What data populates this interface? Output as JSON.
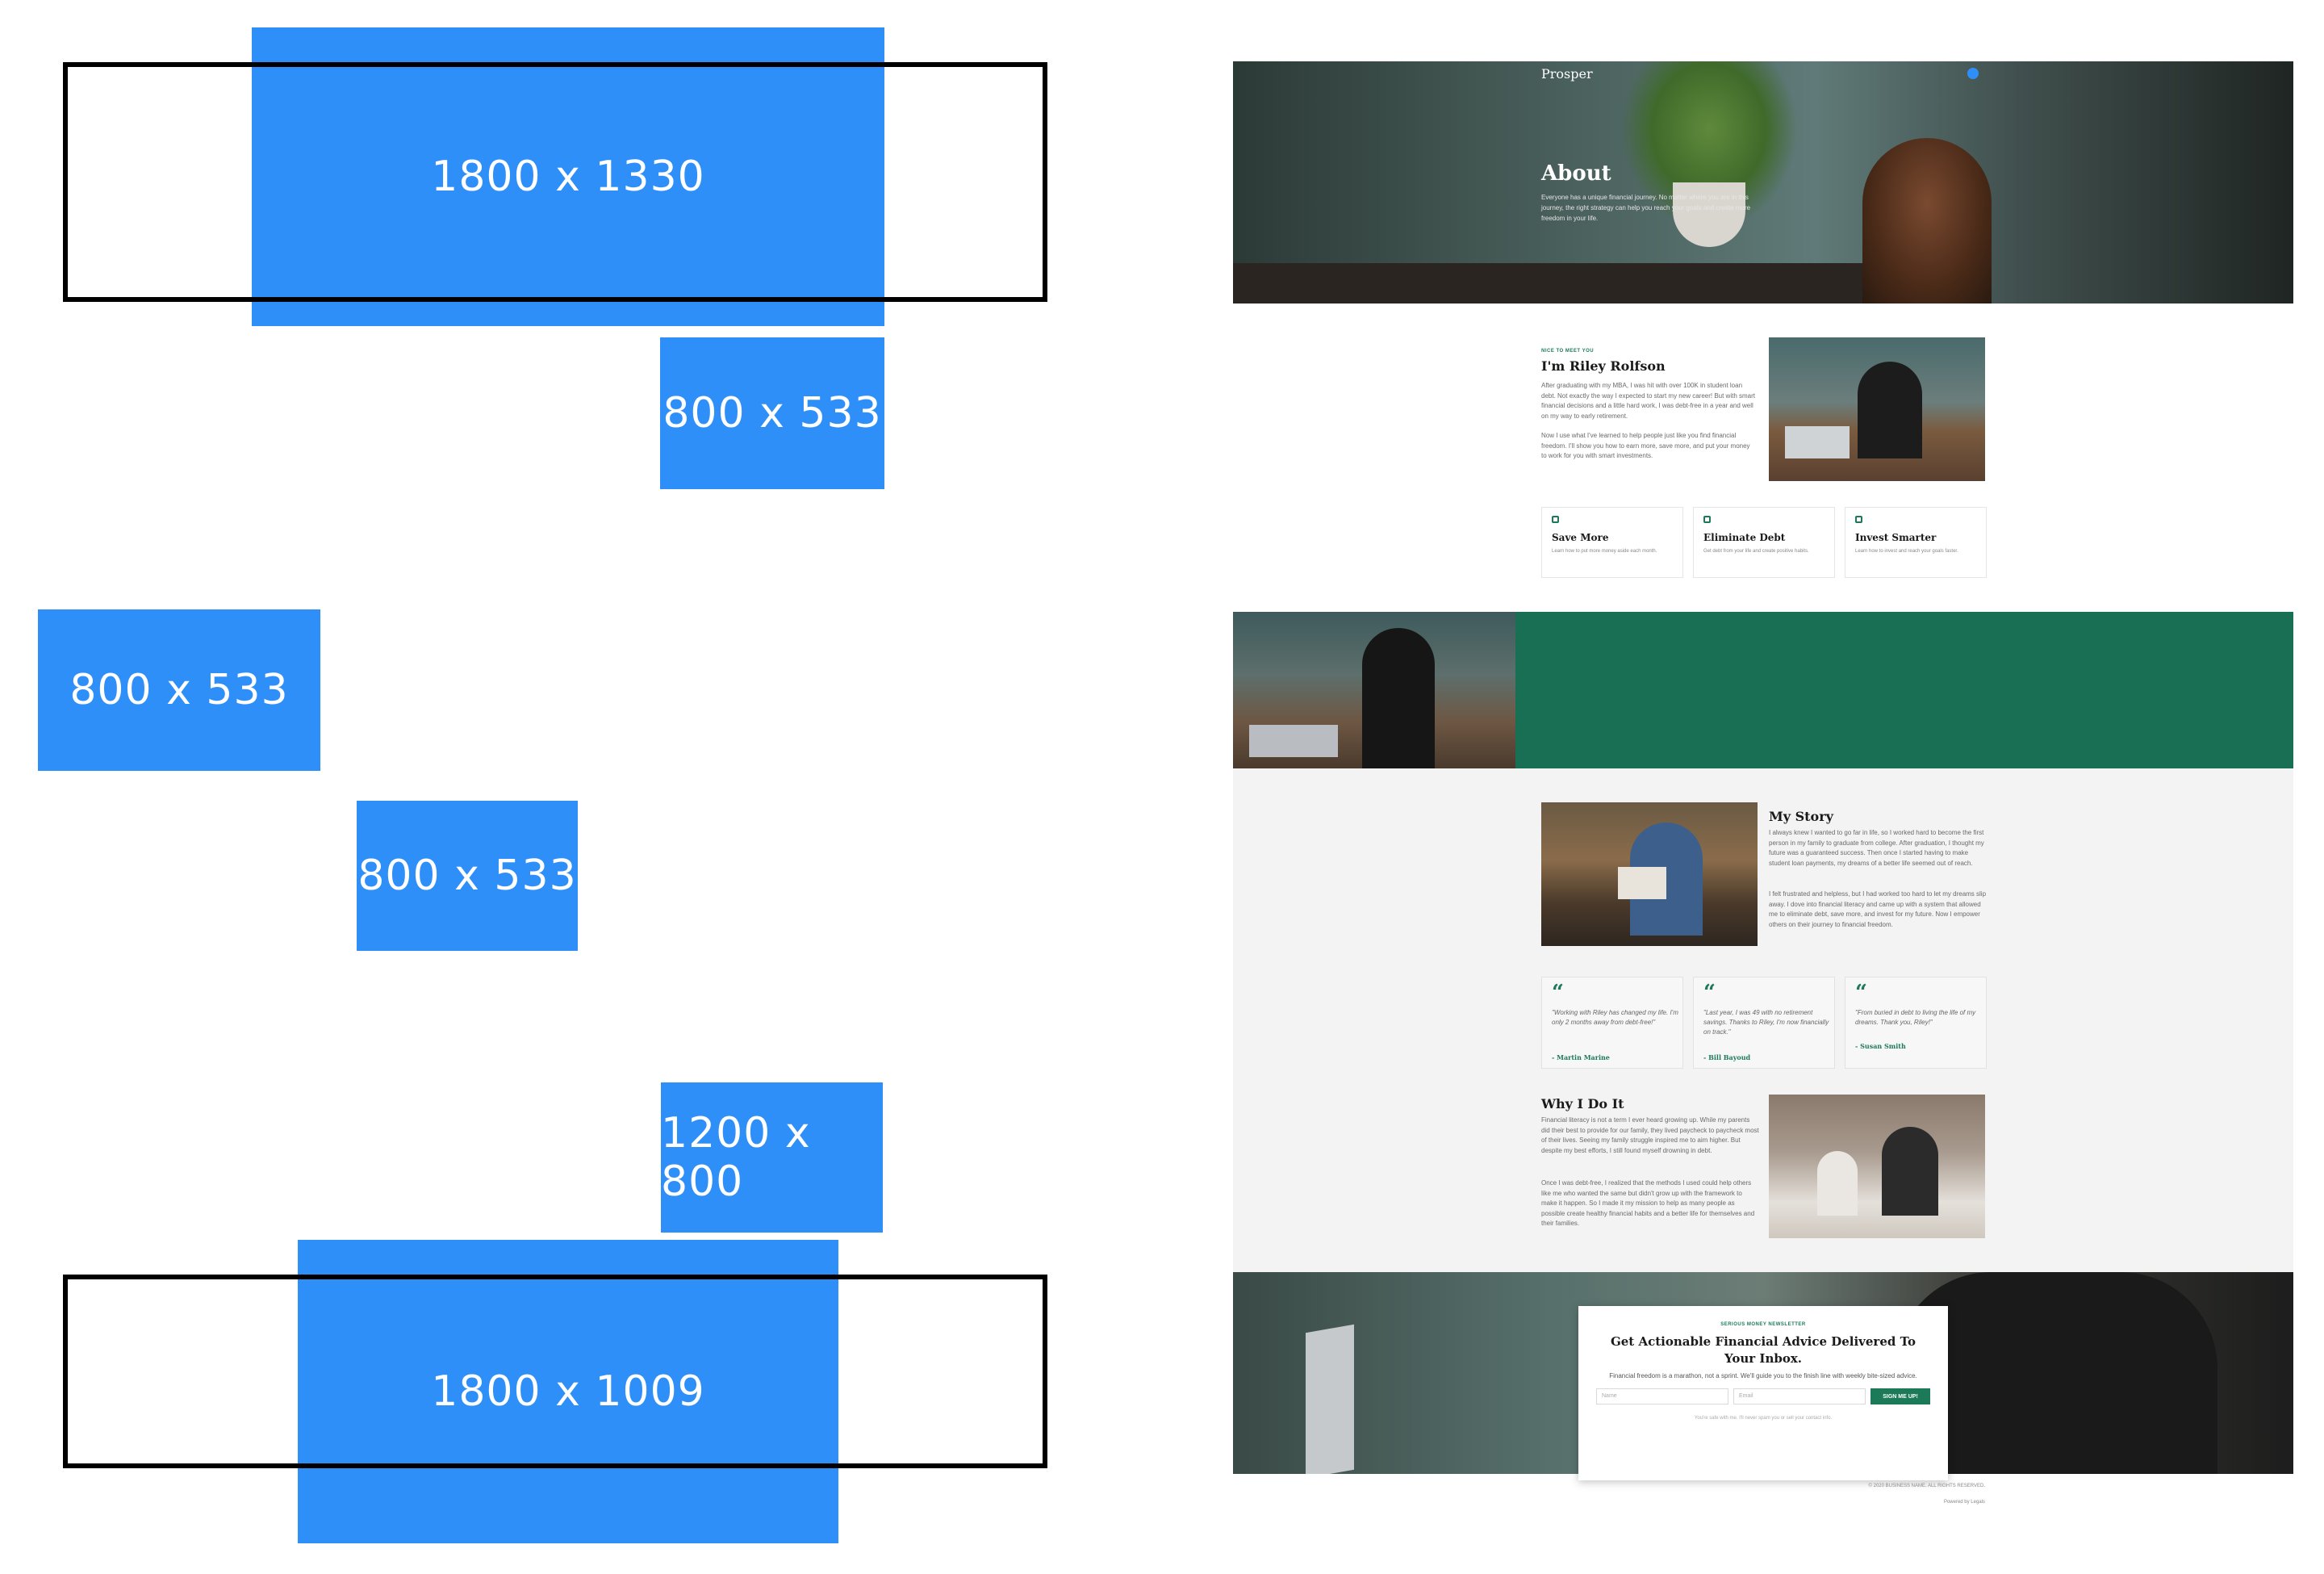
{
  "placeholders": [
    {
      "label": "1800 x 1330"
    },
    {
      "label": "800 x 533"
    },
    {
      "label": "800 x 533"
    },
    {
      "label": "800 x 533"
    },
    {
      "label": "1200 x 800"
    },
    {
      "label": "1800 x 1009"
    }
  ],
  "site": {
    "brand": "Prosper",
    "hero": {
      "title": "About",
      "text": "Everyone has a unique financial journey. No matter where you are in this journey, the right strategy can help you reach your goals and create more freedom in your life."
    },
    "intro": {
      "eyebrow": "NICE TO MEET YOU",
      "name": "I'm Riley Rolfson",
      "p1": "After graduating with my MBA, I was hit with over 100K in student loan debt. Not exactly the way I expected to start my new career! But with smart financial decisions and a little hard work, I was debt-free in a year and well on my way to early retirement.",
      "p2": "Now I use what I've learned to help people just like you find financial freedom. I'll show you how to earn more, save more, and put your money to work for you with smart investments."
    },
    "features": [
      {
        "title": "Save More",
        "text": "Learn how to put more money aside each month."
      },
      {
        "title": "Eliminate Debt",
        "text": "Get debt from your life and create positive habits."
      },
      {
        "title": "Invest Smarter",
        "text": "Learn how to invest and reach your goals faster."
      }
    ],
    "story": {
      "title": "My Story",
      "p1": "I always knew I wanted to go far in life, so I worked hard to become the first person in my family to graduate from college. After graduation, I thought my future was a guaranteed success. Then once I started having to make student loan payments, my dreams of a better life seemed out of reach.",
      "p2": "I felt frustrated and helpless, but I had worked too hard to let my dreams slip away. I dove into financial literacy and came up with a system that allowed me to eliminate debt, save more, and invest for my future. Now I empower others on their journey to financial freedom."
    },
    "testimonials": [
      {
        "quote": "\"Working with Riley has changed my life. I'm only 2 months away from debt-free!\"",
        "author": "- Martin Marine"
      },
      {
        "quote": "\"Last year, I was 49 with no retirement savings. Thanks to Riley, I'm now financially on track.\"",
        "author": "- Bill Bayoud"
      },
      {
        "quote": "\"From buried in debt to living the life of my dreams. Thank you, Riley!\"",
        "author": "- Susan Smith"
      }
    ],
    "why": {
      "title": "Why I Do It",
      "p1": "Financial literacy is not a term I ever heard growing up. While my parents did their best to provide for our family, they lived paycheck to paycheck most of their lives. Seeing my family struggle inspired me to aim higher. But despite my best efforts, I still found myself drowning in debt.",
      "p2": "Once I was debt-free, I realized that the methods I used could help others like me who wanted the same but didn't grow up with the framework to make it happen. So I made it my mission to help as many people as possible create healthy financial habits and a better life for themselves and their families."
    },
    "newsletter": {
      "eyebrow": "SERIOUS MONEY NEWSLETTER",
      "title": "Get Actionable Financial Advice Delivered To Your Inbox.",
      "text": "Financial freedom is a marathon, not a sprint. We'll guide you to the finish line with weekly bite-sized advice.",
      "name_placeholder": "Name",
      "email_placeholder": "Email",
      "button": "SIGN ME UP!",
      "note": "You're safe with me. I'll never spam you or sell your contact info."
    },
    "footer": {
      "copyright": "© 2020 BUSINESS NAME. ALL RIGHTS RESERVED.",
      "powered": "Powered by Legals"
    },
    "colors": {
      "accent": "#1c7a58",
      "placeholder": "#2f8ff9",
      "panel": "#f3f3f3"
    }
  }
}
